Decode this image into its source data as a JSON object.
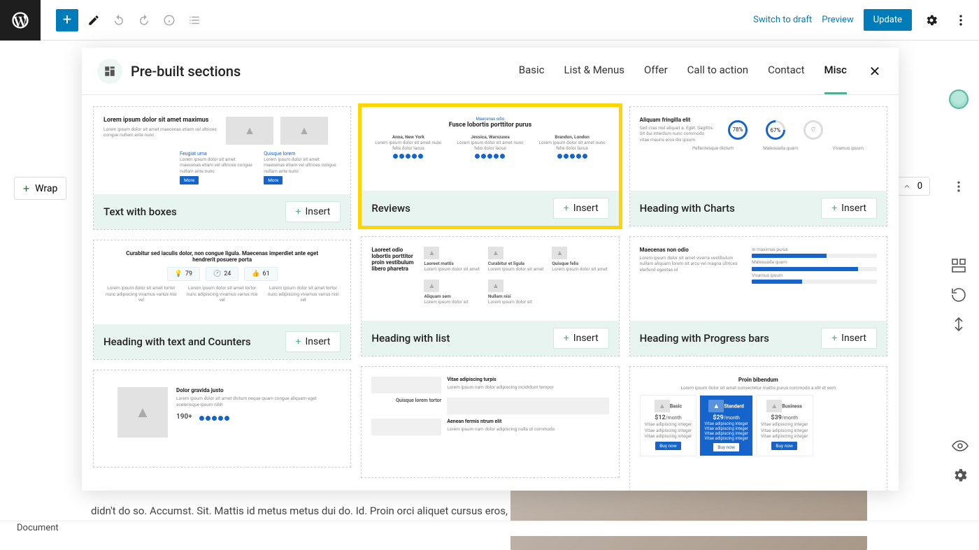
{
  "topbar": {
    "switch_to_draft": "Switch to draft",
    "preview": "Preview",
    "update": "Update"
  },
  "editor": {
    "wrap_label": "Wrap",
    "bg_text": "didn't do so. Accumst. Sit. Mattis id metus metus dui do. Id. Proin orci aliquet cursus eros, sagittis posuere massa fermentum a.",
    "status": "Document",
    "upvotes": "0"
  },
  "modal": {
    "title": "Pre-built sections",
    "tabs": {
      "basic": "Basic",
      "list_menus": "List & Menus",
      "offer": "Offer",
      "call_to_action": "Call to action",
      "contact": "Contact",
      "misc": "Misc"
    },
    "insert_label": "Insert",
    "cards": {
      "text_with_boxes": {
        "title": "Text with boxes",
        "pv": {
          "h1": "Lorem ipsum dolor sit amet maximus",
          "sub1": "Feugiat urna",
          "sub2": "Quisque lorem",
          "p": "Lorem ipsum dolor sit amet maecenas etiam vel ultrices congue nullam ante nunc",
          "btn": "More"
        }
      },
      "reviews": {
        "title": "Reviews",
        "pv": {
          "eyebrow": "Maecenas odio",
          "h": "Fusce lobortis porttitor purus",
          "names": [
            "Anna, New York",
            "Jessica, Warszawa",
            "Brandon, London"
          ],
          "p": "Lorem ipsum dolor sit amet nunc felis dolor lacus"
        }
      },
      "heading_charts": {
        "title": "Heading with Charts",
        "pv": {
          "h": "Aliquam fringilla elit",
          "p": "Sed cras nisl aliquet a. Eget. Sagittis. Sit dui interdum nunc commodo vitae mauris eros dis ipsum",
          "vals": [
            "78%",
            "67%"
          ],
          "labels": [
            "Pellentesque dictum",
            "Malesuada quam",
            "Vivamus ipsum"
          ]
        }
      },
      "heading_counters": {
        "title": "Heading with text and Counters",
        "pv": {
          "h": "Curabitur sed iaculis dolor, non congue ligula. Maecenas imperdiet ante eget hendrerit posuere porta",
          "counts": [
            "79",
            "24",
            "61"
          ],
          "p": "Lorem ipsum dolor sit amet tortor nunc adipiscing vivamus varius nisi vel"
        }
      },
      "heading_list": {
        "title": "Heading with list",
        "pv": {
          "h": "Laoreet odio lobortis porttitor proin vestibulum libero pharetra",
          "items": [
            "Laoreet mattis",
            "Curabitur et ligula",
            "Quisque felis"
          ],
          "sub": [
            "Aliquam sem",
            "Nullam nisi"
          ]
        }
      },
      "heading_progress": {
        "title": "Heading with Progress bars",
        "pv": {
          "h": "Maecenas non odio",
          "p": "Lorem ipsum dolor sit amet viverra vestibulum nullam aliquam lorem sit arcu vel magna ultrices eleifend egestas id",
          "labels": [
            "In maximus purus",
            "Malesuada quam",
            "Vivamus ipsum"
          ]
        }
      },
      "about_team": {
        "pv": {
          "h": "Dolor gravida justo",
          "p": "Lorem ipsum dolor sit amet dictum neque quam congue aliquam eget scelerisque ipsum nibh",
          "count": "190+"
        }
      },
      "feature_list": {
        "pv": {
          "t1": "Vitae adipiscing turpis",
          "t2": "Quisque lorem tortor",
          "t3": "Aenean fermis ntrum elit"
        }
      },
      "pricing": {
        "pv": {
          "h": "Proin bibendum",
          "p": "Lorem ipsum dolor sit amet consectetur mattis purus commodo a elit et sem",
          "tiers": [
            "Basic",
            "Standard",
            "Business"
          ],
          "prices": [
            "$12",
            "$29",
            "$39"
          ],
          "period": "/month",
          "line": "Vitae adipiscing integer",
          "buy": "Buy now"
        }
      }
    }
  }
}
